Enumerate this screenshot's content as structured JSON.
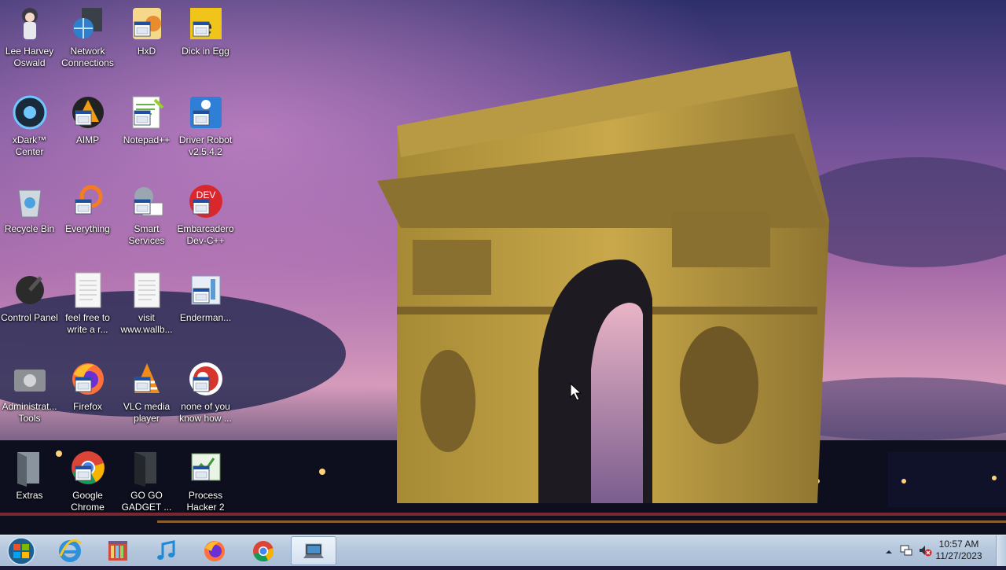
{
  "desktop": {
    "icons": [
      {
        "label": "Lee Harvey Oswald",
        "icon": "anime-character-icon"
      },
      {
        "label": "Network Connections",
        "icon": "network-globe-icon"
      },
      {
        "label": "HxD",
        "icon": "hex-editor-icon"
      },
      {
        "label": "Dick in Egg",
        "icon": "app-e-icon"
      },
      {
        "label": "xDark™ Center",
        "icon": "xdark-center-icon"
      },
      {
        "label": "AIMP",
        "icon": "aimp-icon"
      },
      {
        "label": "Notepad++",
        "icon": "notepad-plus-plus-icon"
      },
      {
        "label": "Driver Robot v2.5.4.2",
        "icon": "driver-robot-icon"
      },
      {
        "label": "Recycle Bin",
        "icon": "recycle-bin-icon"
      },
      {
        "label": "Everything",
        "icon": "everything-search-icon"
      },
      {
        "label": "Smart Services",
        "icon": "smart-services-icon"
      },
      {
        "label": "Embarcadero Dev-C++",
        "icon": "dev-cpp-icon"
      },
      {
        "label": "Control Panel",
        "icon": "control-panel-icon"
      },
      {
        "label": "feel free to write a r...",
        "icon": "text-document-icon"
      },
      {
        "label": "visit www.wallb...",
        "icon": "text-document-icon"
      },
      {
        "label": "Enderman...",
        "icon": "app-window-icon"
      },
      {
        "label": "Administrat... Tools",
        "icon": "admin-tools-icon"
      },
      {
        "label": "Firefox",
        "icon": "firefox-icon"
      },
      {
        "label": "VLC media player",
        "icon": "vlc-icon"
      },
      {
        "label": "none of you know how ...",
        "icon": "red-circle-app-icon"
      },
      {
        "label": "Extras",
        "icon": "folder-icon"
      },
      {
        "label": "Google Chrome",
        "icon": "chrome-icon"
      },
      {
        "label": "GO GO GADGET ...",
        "icon": "folder-dark-icon"
      },
      {
        "label": "Process Hacker 2",
        "icon": "process-hacker-icon"
      }
    ]
  },
  "taskbar": {
    "start": "windows-start-orb-icon",
    "pinned": [
      {
        "icon": "internet-explorer-icon"
      },
      {
        "icon": "library-icon"
      },
      {
        "icon": "itunes-music-icon"
      },
      {
        "icon": "firefox-icon"
      },
      {
        "icon": "chrome-icon"
      },
      {
        "icon": "laptop-app-icon",
        "active": true
      }
    ],
    "tray": {
      "show_hidden": "chevron-up-icon",
      "network": "network-icon",
      "volume": "volume-muted-icon",
      "time": "10:57 AM",
      "date": "11/27/2023"
    }
  },
  "colors": {
    "sky_top": "#3b2f6b",
    "sky_mid": "#9a6aa8",
    "sky_horizon": "#e0a6b8",
    "arch_stone": "#b99a3c",
    "taskbar": "#b9cbe0"
  }
}
